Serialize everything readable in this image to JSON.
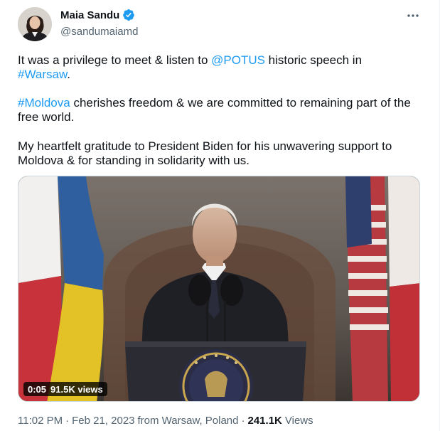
{
  "author": {
    "name": "Maia Sandu",
    "handle": "@sandumaiamd",
    "verified_color": "#1d9bf0"
  },
  "more_icon": "more-horizontal-icon",
  "tweet": {
    "p1_a": "It was a privilege to meet & listen to ",
    "p1_mention": "@POTUS",
    "p1_b": " historic speech in",
    "p1_hashtag": "#Warsaw",
    "p1_c": ".",
    "p2_hashtag": "#Moldova",
    "p2_a": " cherishes freedom & we are committed to remaining part of the free world.",
    "p3": "My heartfelt gratitude to President Biden for his unwavering support to Moldova & for standing in solidarity with us."
  },
  "video": {
    "duration": "0:05",
    "views": "91.5K views"
  },
  "meta": {
    "time": "11:02 PM",
    "sep1": "·",
    "date": "Feb 21, 2023",
    "from": "from Warsaw, Poland",
    "sep2": "·",
    "views_count": "241.1K",
    "views_label": "Views"
  },
  "colors": {
    "link": "#1d9bf0",
    "text": "#0f1419",
    "secondary": "#536471"
  }
}
